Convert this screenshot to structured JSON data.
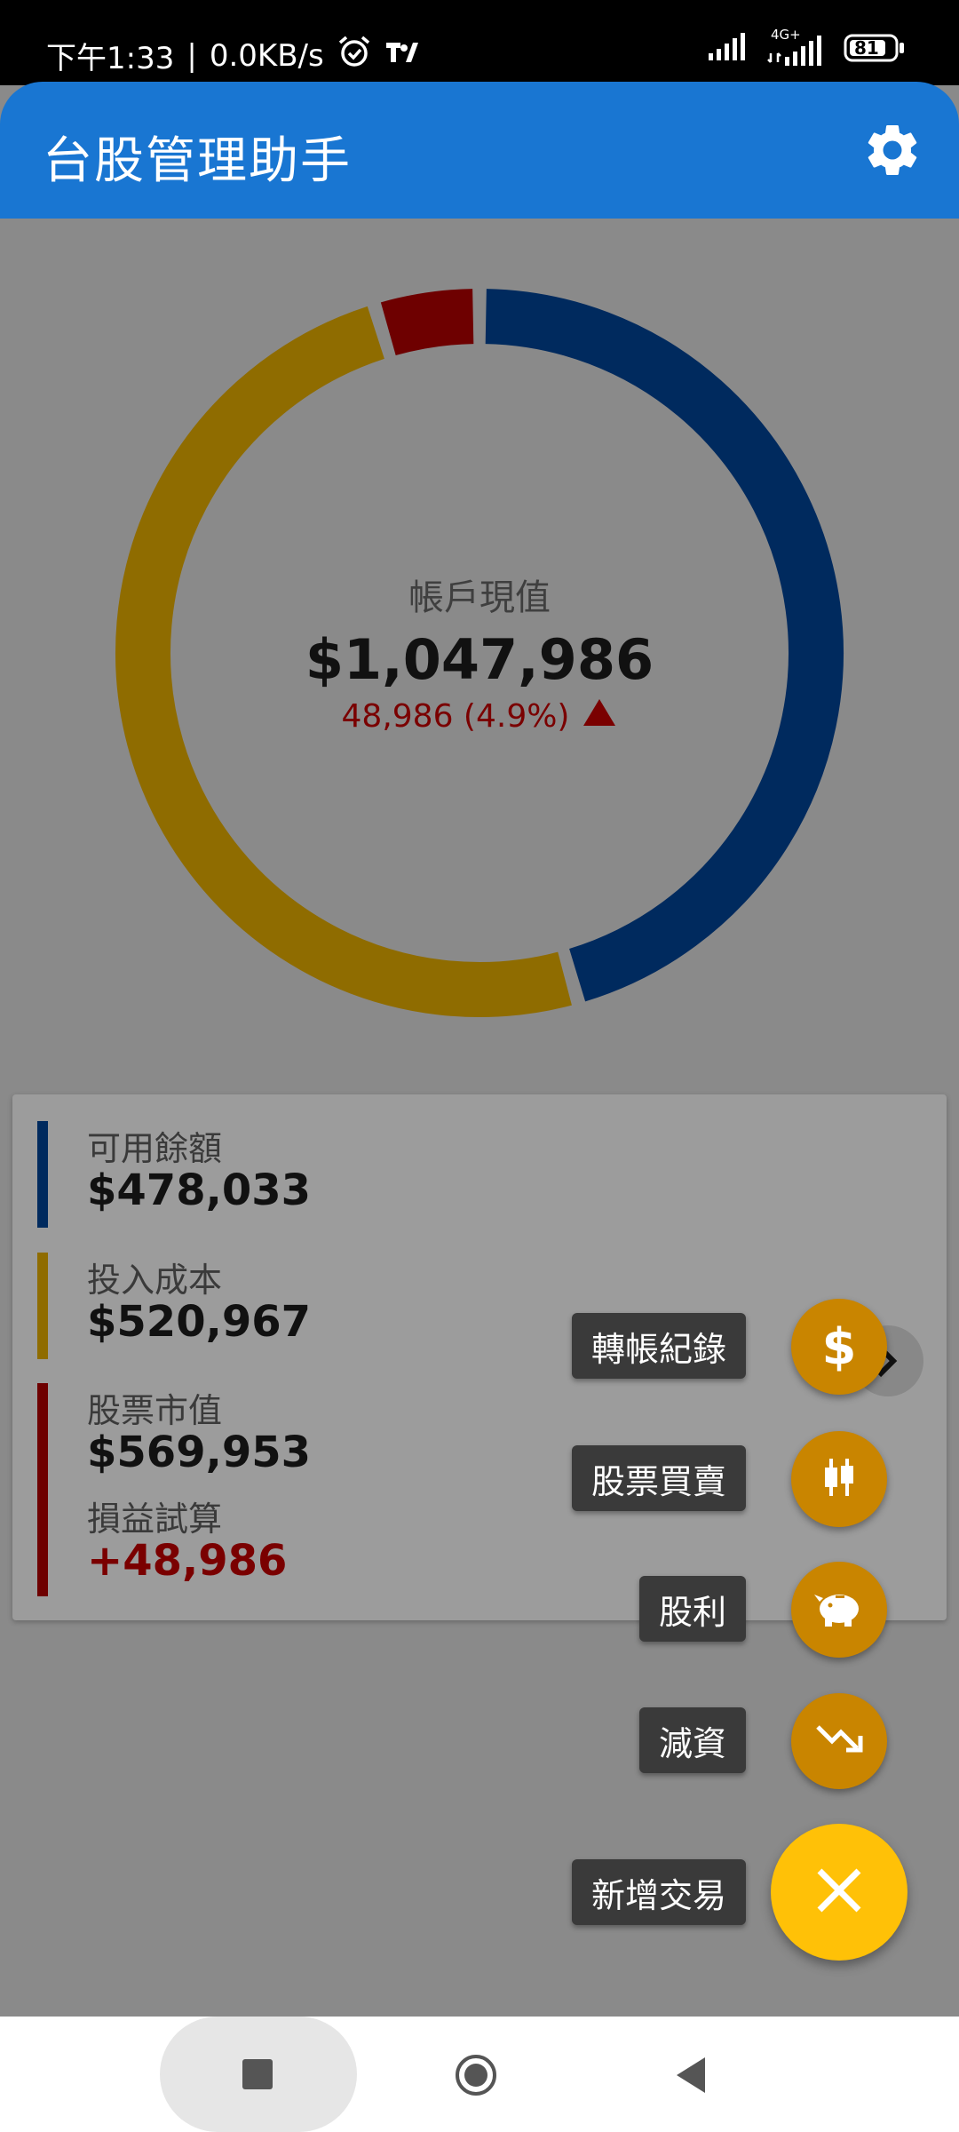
{
  "status_bar": {
    "time": "下午1:33",
    "net_speed": "0.0KB/s",
    "battery": "81",
    "icons": [
      "alarm-icon",
      "app-notification-icon",
      "signal-icon",
      "signal-4g-icon",
      "battery-icon"
    ],
    "net_label": "4G+"
  },
  "app_bar": {
    "title": "台股管理助手",
    "settings_icon": "gear-icon"
  },
  "donut": {
    "center_label": "帳戶現值",
    "center_value": "$1,047,986",
    "change_text": "48,986 (4.9%)",
    "change_icon": "triangle-up-icon",
    "colors": {
      "available": "#002a5e",
      "cost": "#8f6c00",
      "stock": "#6e0000"
    }
  },
  "chart_data": {
    "type": "donut",
    "segments": [
      {
        "name": "可用餘額",
        "value": 478033,
        "color": "#002a5e"
      },
      {
        "name": "投入成本",
        "value": 520967,
        "color": "#8f6c00"
      },
      {
        "name": "損益試算",
        "value": 48986,
        "color": "#6e0000"
      }
    ]
  },
  "summary": {
    "available_label": "可用餘額",
    "available_value": "$478,033",
    "cost_label": "投入成本",
    "cost_value": "$520,967",
    "market_label": "股票市值",
    "market_value": "$569,953",
    "pnl_label": "損益試算",
    "pnl_value": "+48,986"
  },
  "fab_menu": {
    "transfer_label": "轉帳紀錄",
    "trade_label": "股票買賣",
    "dividend_label": "股利",
    "capital_reduction_label": "減資",
    "new_trade_label": "新增交易",
    "icons": [
      "dollar-icon",
      "candlestick-icon",
      "piggy-bank-icon",
      "trending-down-icon",
      "close-icon"
    ]
  },
  "nav_bar": {
    "icons": [
      "recents-square-icon",
      "home-circle-icon",
      "back-triangle-icon"
    ]
  },
  "colors": {
    "app_bar": "#1976d2",
    "fab_small": "#c98500",
    "fab_main": "#ffc107",
    "pnl_positive": "#7a0000",
    "scrim_background": "#8a8a8a"
  }
}
